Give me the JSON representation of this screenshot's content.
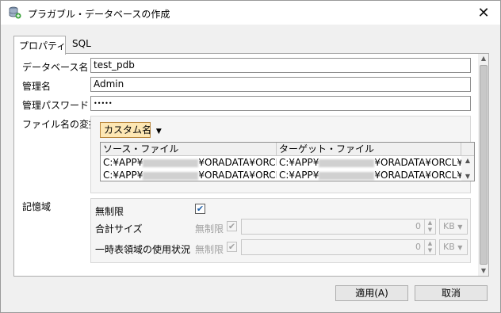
{
  "window": {
    "title": "プラガブル・データベースの作成",
    "close_label": "✕"
  },
  "tabs": [
    {
      "label": "プロパティ",
      "active": true
    },
    {
      "label": "SQL",
      "active": false
    }
  ],
  "form": {
    "db_name_label": "データベース名",
    "db_name_value": "test_pdb",
    "admin_label": "管理名",
    "admin_value": "Admin",
    "password_label": "管理パスワード",
    "password_value": "•••••",
    "file_convert_label": "ファイル名の変換",
    "convert_dropdown": "カスタム名",
    "table": {
      "headers": [
        "ソース・ファイル",
        "ターゲット・ファイル"
      ],
      "rows": [
        {
          "source_prefix": "C:¥APP¥",
          "source_suffix": "¥ORADATA¥ORCL¥P...",
          "target_prefix": "C:¥APP¥",
          "target_suffix": "¥ORADATA¥ORCL¥P..."
        },
        {
          "source_prefix": "C:¥APP¥",
          "source_suffix": "¥ORADATA¥ORCL¥P...",
          "target_prefix": "C:¥APP¥",
          "target_suffix": "¥ORADATA¥ORCL¥P..."
        }
      ]
    },
    "storage_label": "記憶域",
    "unlimited_label": "無制限",
    "unlimited_checked": true,
    "total_size_label": "合計サイズ",
    "total_unlimited_label": "無制限",
    "total_value": "0",
    "total_unit": "KB",
    "temp_label": "一時表領域の使用状況",
    "temp_unlimited_label": "無制限",
    "temp_value": "0",
    "temp_unit": "KB"
  },
  "buttons": {
    "apply": "適用(A)",
    "cancel": "取消"
  },
  "colors": {
    "dropdown_bg": "#fde7b4",
    "checkbox_accent": "#1e5fa8"
  }
}
